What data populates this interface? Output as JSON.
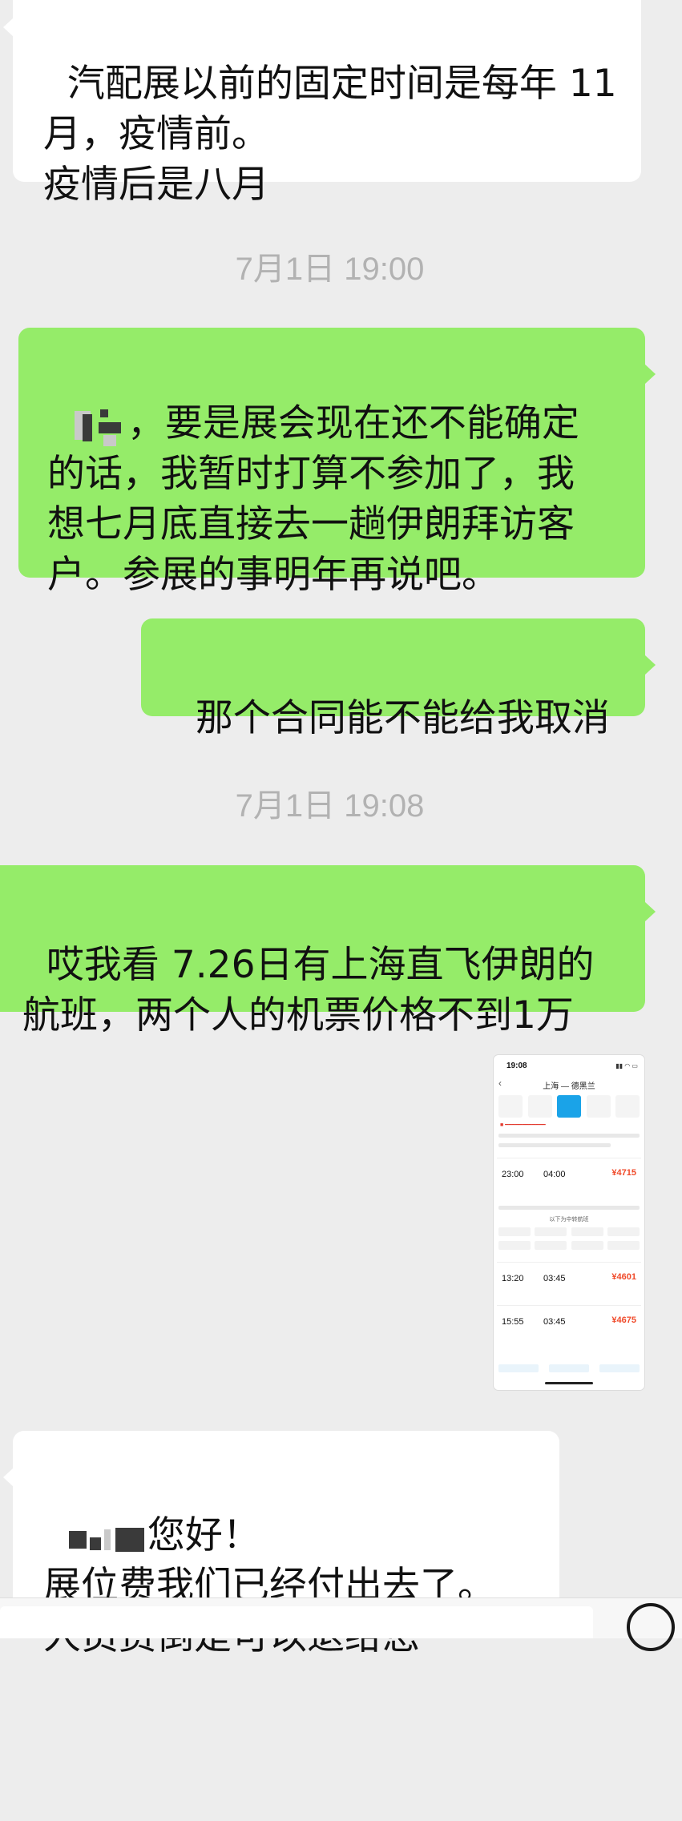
{
  "messages": [
    {
      "id": "m1",
      "direction": "incoming",
      "text": "汽配展以前的固定时间是每年 11\n月，疫情前。\n疫情后是八月"
    },
    {
      "id": "t1",
      "type": "timestamp",
      "text": "7月1日 19:00"
    },
    {
      "id": "m2",
      "direction": "outgoing",
      "text": "，要是展会现在还不能确定\n的话，我暂时打算不参加了，我\n想七月底直接去一趟伊朗拜访客\n户。参展的事明年再说吧。"
    },
    {
      "id": "m3",
      "direction": "outgoing",
      "text": "那个合同能不能给我取消"
    },
    {
      "id": "t2",
      "type": "timestamp",
      "text": "7月1日 19:08"
    },
    {
      "id": "m4",
      "direction": "outgoing",
      "text": "哎我看 7.26日有上海直飞伊朗的\n航班，两个人的机票价格不到1万"
    },
    {
      "id": "m5",
      "direction": "outgoing",
      "type": "image",
      "screenshot": {
        "status_time": "19:08",
        "route": "上海 — 德黑兰",
        "flights": [
          {
            "dep": "23:00",
            "arr": "04:00",
            "price": "¥4715"
          },
          {
            "dep": "13:20",
            "arr": "03:45",
            "price": "¥4601"
          },
          {
            "dep": "15:55",
            "arr": "03:45",
            "price": "¥4675"
          }
        ],
        "section_label": "以下为中转航班"
      }
    },
    {
      "id": "m6",
      "direction": "incoming",
      "text": "您好！\n展位费我们已经付出去了。\n人员费倒是可以退给您"
    }
  ],
  "colors": {
    "background": "#ededed",
    "incoming_bubble": "#ffffff",
    "outgoing_bubble": "#95ec69",
    "timestamp_text": "#b2b2b2",
    "price_text": "#f04a2a"
  },
  "icons": {
    "input_right": "voice-circle-icon"
  }
}
